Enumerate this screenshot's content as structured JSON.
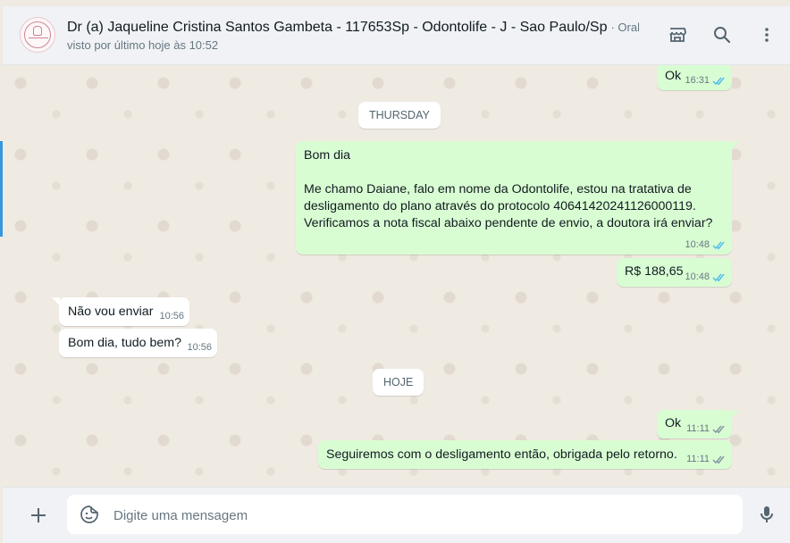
{
  "header": {
    "contact_name": "Dr (a) Jaqueline Cristina Santos Gambeta - 117653Sp - Odontolife - J - Sao Paulo/Sp",
    "contact_sub": "· Oral...",
    "status": "visto por último hoje às 10:52",
    "icons": [
      "avatar-logo",
      "catalog-icon",
      "search-icon",
      "menu-icon"
    ]
  },
  "chat": {
    "messages": [
      {
        "dir": "out",
        "text": "Ok",
        "time": "16:31",
        "ticks": "read"
      },
      {
        "dir": "out",
        "text": "Bom dia\n\nMe chamo Daiane, falo em nome da Odontolife, estou na tratativa de\ndesligamento do plano através do protocolo 40641420241126000119.\nVerificamos a nota fiscal abaixo pendente de envio, a doutora irá enviar?",
        "time": "10:48",
        "ticks": "read"
      },
      {
        "dir": "out",
        "text": "R$ 188,65",
        "time": "10:48",
        "ticks": "read"
      },
      {
        "dir": "in",
        "text": "Não vou enviar",
        "time": "10:56"
      },
      {
        "dir": "in",
        "text": "Bom dia, tudo bem?",
        "time": "10:56"
      },
      {
        "dir": "out",
        "text": "Ok",
        "time": "11:11",
        "ticks": "delivered"
      },
      {
        "dir": "out",
        "text": "Seguiremos com o desligamento então, obrigada pelo retorno.",
        "time": "11:11",
        "ticks": "delivered"
      }
    ],
    "date_chips": [
      "THURSDAY",
      "HOJE"
    ]
  },
  "composer": {
    "placeholder": "Digite uma mensagem",
    "value": "",
    "icons": [
      "plus-icon",
      "emoji-icon",
      "mic-icon"
    ]
  },
  "colors": {
    "outgoing_bubble": "#d9fdd3",
    "incoming_bubble": "#ffffff",
    "chat_background": "#efeae2",
    "read_tick": "#53bdeb",
    "delivered_tick": "#8696a0",
    "header_background": "#f0f2f5"
  }
}
